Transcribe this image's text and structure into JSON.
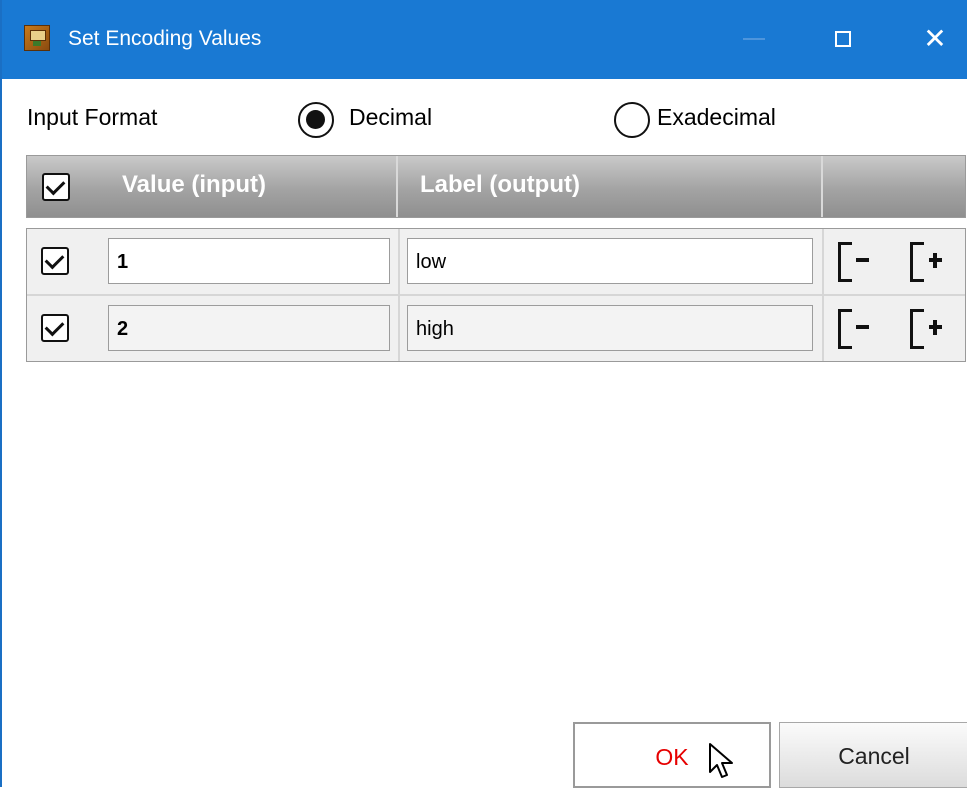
{
  "window": {
    "title": "Set Encoding Values",
    "controls": [
      "maximize-icon",
      "close-icon"
    ],
    "accent_color": "#1979d3"
  },
  "input_format": {
    "label": "Input Format",
    "options": [
      {
        "label": "Decimal",
        "selected": true
      },
      {
        "label": "Exadecimal",
        "selected": false
      }
    ]
  },
  "table": {
    "headers": {
      "value": "Value (input)",
      "label": "Label (output)"
    },
    "rows": [
      {
        "checked": true,
        "value": "1",
        "label": "low"
      },
      {
        "checked": true,
        "value": "2",
        "label": "high"
      }
    ],
    "row_action_icons": [
      "remove-row-icon",
      "add-row-icon"
    ]
  },
  "buttons": {
    "ok": "OK",
    "cancel": "Cancel",
    "ok_text_color": "#e60000"
  }
}
